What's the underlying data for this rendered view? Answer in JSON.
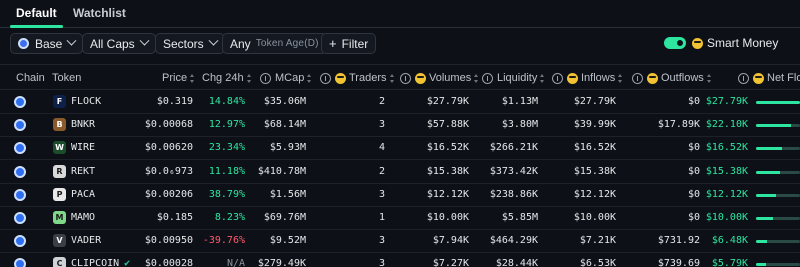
{
  "tabs": [
    {
      "label": "Default",
      "active": true
    },
    {
      "label": "Watchlist",
      "active": false
    }
  ],
  "filters": {
    "chain": "Base",
    "caps": "All Caps",
    "sectors": "Sectors",
    "age_prefix": "Any",
    "age_label": "Token Age(D)",
    "add_filter": "Filter",
    "smart_money": "Smart Money",
    "smart_money_enabled": true
  },
  "columns": {
    "chain": "Chain",
    "token": "Token",
    "price": "Price",
    "chg": "Chg 24h",
    "mcap": "MCap",
    "traders": "Traders",
    "volumes": "Volumes",
    "liquidity": "Liquidity",
    "inflows": "Inflows",
    "outflows": "Outflows",
    "netflow": "Net Flow"
  },
  "colors": {
    "accent": "#2ee6a0",
    "negative": "#ff5a6a",
    "chain": "#2d6ff0"
  },
  "rows": [
    {
      "token": "FLOCK",
      "icon_color": "#0e1f4a",
      "icon_glyph": "F",
      "price": "$0.319",
      "chg": "14.84%",
      "chg_dir": "up",
      "mcap": "$35.06M",
      "traders": "2",
      "volumes": "$27.79K",
      "liquidity": "$1.13M",
      "inflows": "$27.79K",
      "outflows": "$0",
      "netflow": "$27.79K",
      "net_dir": "up",
      "net_ratio": 1.0
    },
    {
      "token": "BNKR",
      "icon_color": "#8a5a2b",
      "icon_glyph": "B",
      "price": "$0.00068",
      "chg": "12.97%",
      "chg_dir": "up",
      "mcap": "$68.14M",
      "traders": "3",
      "volumes": "$57.88K",
      "liquidity": "$3.80M",
      "inflows": "$39.99K",
      "outflows": "$17.89K",
      "netflow": "$22.10K",
      "net_dir": "up",
      "net_ratio": 0.8
    },
    {
      "token": "WIRE",
      "icon_color": "#1b4d2a",
      "icon_glyph": "W",
      "price": "$0.00620",
      "chg": "23.34%",
      "chg_dir": "up",
      "mcap": "$5.93M",
      "traders": "4",
      "volumes": "$16.52K",
      "liquidity": "$266.21K",
      "inflows": "$16.52K",
      "outflows": "$0",
      "netflow": "$16.52K",
      "net_dir": "up",
      "net_ratio": 0.6
    },
    {
      "token": "REKT",
      "icon_color": "#d9d9d9",
      "icon_glyph": "R",
      "price": "$0.0₆973",
      "chg": "11.18%",
      "chg_dir": "up",
      "mcap": "$410.78M",
      "traders": "2",
      "volumes": "$15.38K",
      "liquidity": "$373.42K",
      "inflows": "$15.38K",
      "outflows": "$0",
      "netflow": "$15.38K",
      "net_dir": "up",
      "net_ratio": 0.55
    },
    {
      "token": "PACA",
      "icon_color": "#e8e8e8",
      "icon_glyph": "P",
      "price": "$0.00206",
      "chg": "38.79%",
      "chg_dir": "up",
      "mcap": "$1.56M",
      "traders": "3",
      "volumes": "$12.12K",
      "liquidity": "$238.86K",
      "inflows": "$12.12K",
      "outflows": "$0",
      "netflow": "$12.12K",
      "net_dir": "up",
      "net_ratio": 0.45
    },
    {
      "token": "MAMO",
      "icon_color": "#7fd88a",
      "icon_glyph": "M",
      "price": "$0.185",
      "chg": "8.23%",
      "chg_dir": "up",
      "mcap": "$69.76M",
      "traders": "1",
      "volumes": "$10.00K",
      "liquidity": "$5.85M",
      "inflows": "$10.00K",
      "outflows": "$0",
      "netflow": "$10.00K",
      "net_dir": "up",
      "net_ratio": 0.38
    },
    {
      "token": "VADER",
      "icon_color": "#3a3f47",
      "icon_glyph": "V",
      "price": "$0.00950",
      "chg": "-39.76%",
      "chg_dir": "down",
      "mcap": "$9.52M",
      "traders": "3",
      "volumes": "$7.94K",
      "liquidity": "$464.29K",
      "inflows": "$7.21K",
      "outflows": "$731.92",
      "netflow": "$6.48K",
      "net_dir": "up",
      "net_ratio": 0.24
    },
    {
      "token": "CLIPCOIN",
      "icon_color": "#cfd3d8",
      "icon_glyph": "C",
      "verified": true,
      "price": "$0.00028",
      "chg": "N/A",
      "chg_dir": "na",
      "mcap": "$279.49K",
      "traders": "3",
      "volumes": "$7.27K",
      "liquidity": "$28.44K",
      "inflows": "$6.53K",
      "outflows": "$739.69",
      "netflow": "$5.79K",
      "net_dir": "up",
      "net_ratio": 0.22
    }
  ]
}
